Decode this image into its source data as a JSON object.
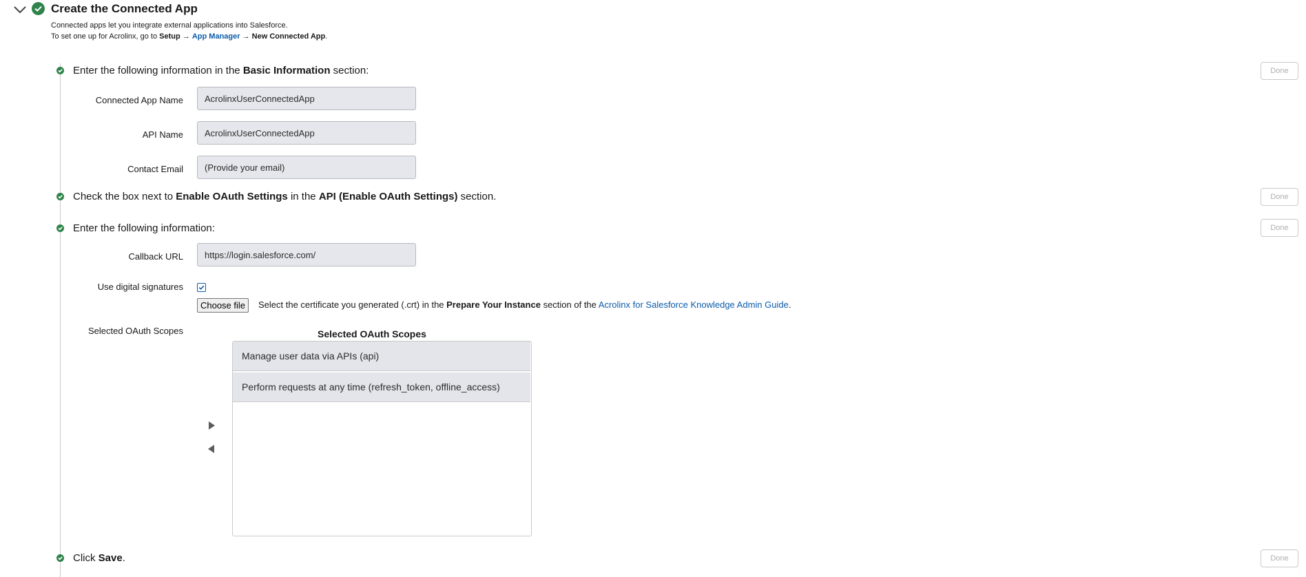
{
  "section": {
    "title": "Create the Connected App",
    "desc1": "Connected apps let you integrate external applications into Salesforce.",
    "desc2_pre": "To set one up for Acrolinx, go to ",
    "desc2_setup": "Setup",
    "desc2_arrow1": " → ",
    "desc2_appmgr": "App Manager",
    "desc2_arrow2": " → ",
    "desc2_new": "New Connected App",
    "desc2_end": "."
  },
  "steps": [
    {
      "pre": "Enter the following information in the ",
      "bold": "Basic Information",
      "post": " section:",
      "done_label": "Done"
    },
    {
      "pre": "Check the box next to ",
      "bold1": "Enable OAuth Settings",
      "mid": " in the ",
      "bold2": "API (Enable OAuth Settings)",
      "post": " section.",
      "done_label": "Done"
    },
    {
      "text": "Enter the following information:",
      "done_label": "Done"
    },
    {
      "pre": "Click ",
      "bold": "Save",
      "post": ".",
      "done_label": "Done"
    }
  ],
  "basic_info": {
    "app_name_label": "Connected App Name",
    "app_name_value": "AcrolinxUserConnectedApp",
    "api_name_label": "API Name",
    "api_name_value": "AcrolinxUserConnectedApp",
    "email_label": "Contact Email",
    "email_value": "(Provide your email)"
  },
  "oauth": {
    "callback_label": "Callback URL",
    "callback_value": "https://login.salesforce.com/",
    "digital_sig_label": "Use digital signatures",
    "digital_sig_checked": true,
    "choose_file_label": "Choose file",
    "cert_pre": "Select the certificate you generated (.crt) in the ",
    "cert_bold": "Prepare Your Instance",
    "cert_mid": " section of the ",
    "cert_link": "Acrolinx for Salesforce Knowledge Admin Guide",
    "cert_end": ".",
    "scopes_label": "Selected OAuth Scopes",
    "scopes_header": "Selected OAuth Scopes",
    "scopes": [
      "Manage user data via APIs (api)",
      "Perform requests at any time (refresh_token, offline_access)"
    ]
  },
  "colors": {
    "success": "#2e844a",
    "link": "#0b5cab"
  }
}
